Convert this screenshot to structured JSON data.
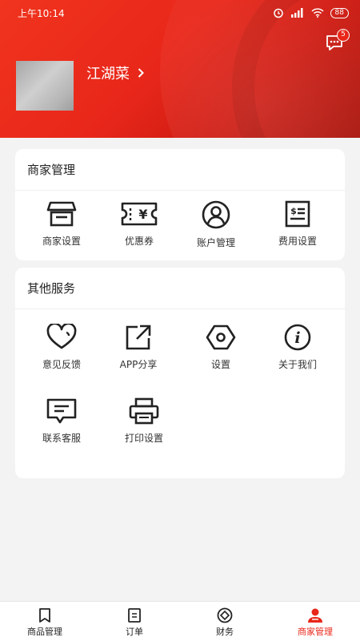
{
  "status_bar": {
    "time": "上午10:14",
    "battery": "88"
  },
  "header": {
    "message_badge": "5",
    "username": "江湖菜",
    "accent": "#e8271a"
  },
  "merchant_section": {
    "title": "商家管理",
    "items": [
      {
        "label": "商家设置",
        "icon": "store-icon"
      },
      {
        "label": "优惠券",
        "icon": "coupon-icon"
      },
      {
        "label": "账户管理",
        "icon": "account-icon"
      },
      {
        "label": "费用设置",
        "icon": "fee-icon"
      }
    ]
  },
  "other_section": {
    "title": "其他服务",
    "items": [
      {
        "label": "意见反馈",
        "icon": "heart-icon"
      },
      {
        "label": "APP分享",
        "icon": "share-icon"
      },
      {
        "label": "设置",
        "icon": "settings-icon"
      },
      {
        "label": "关于我们",
        "icon": "info-icon"
      },
      {
        "label": "联系客服",
        "icon": "chat-icon"
      },
      {
        "label": "打印设置",
        "icon": "printer-icon"
      }
    ]
  },
  "tabbar": {
    "tabs": [
      {
        "label": "商品管理",
        "icon": "bookmark-icon"
      },
      {
        "label": "订单",
        "icon": "document-icon"
      },
      {
        "label": "财务",
        "icon": "finance-icon"
      },
      {
        "label": "商家管理",
        "icon": "user-icon",
        "active": true
      }
    ]
  }
}
